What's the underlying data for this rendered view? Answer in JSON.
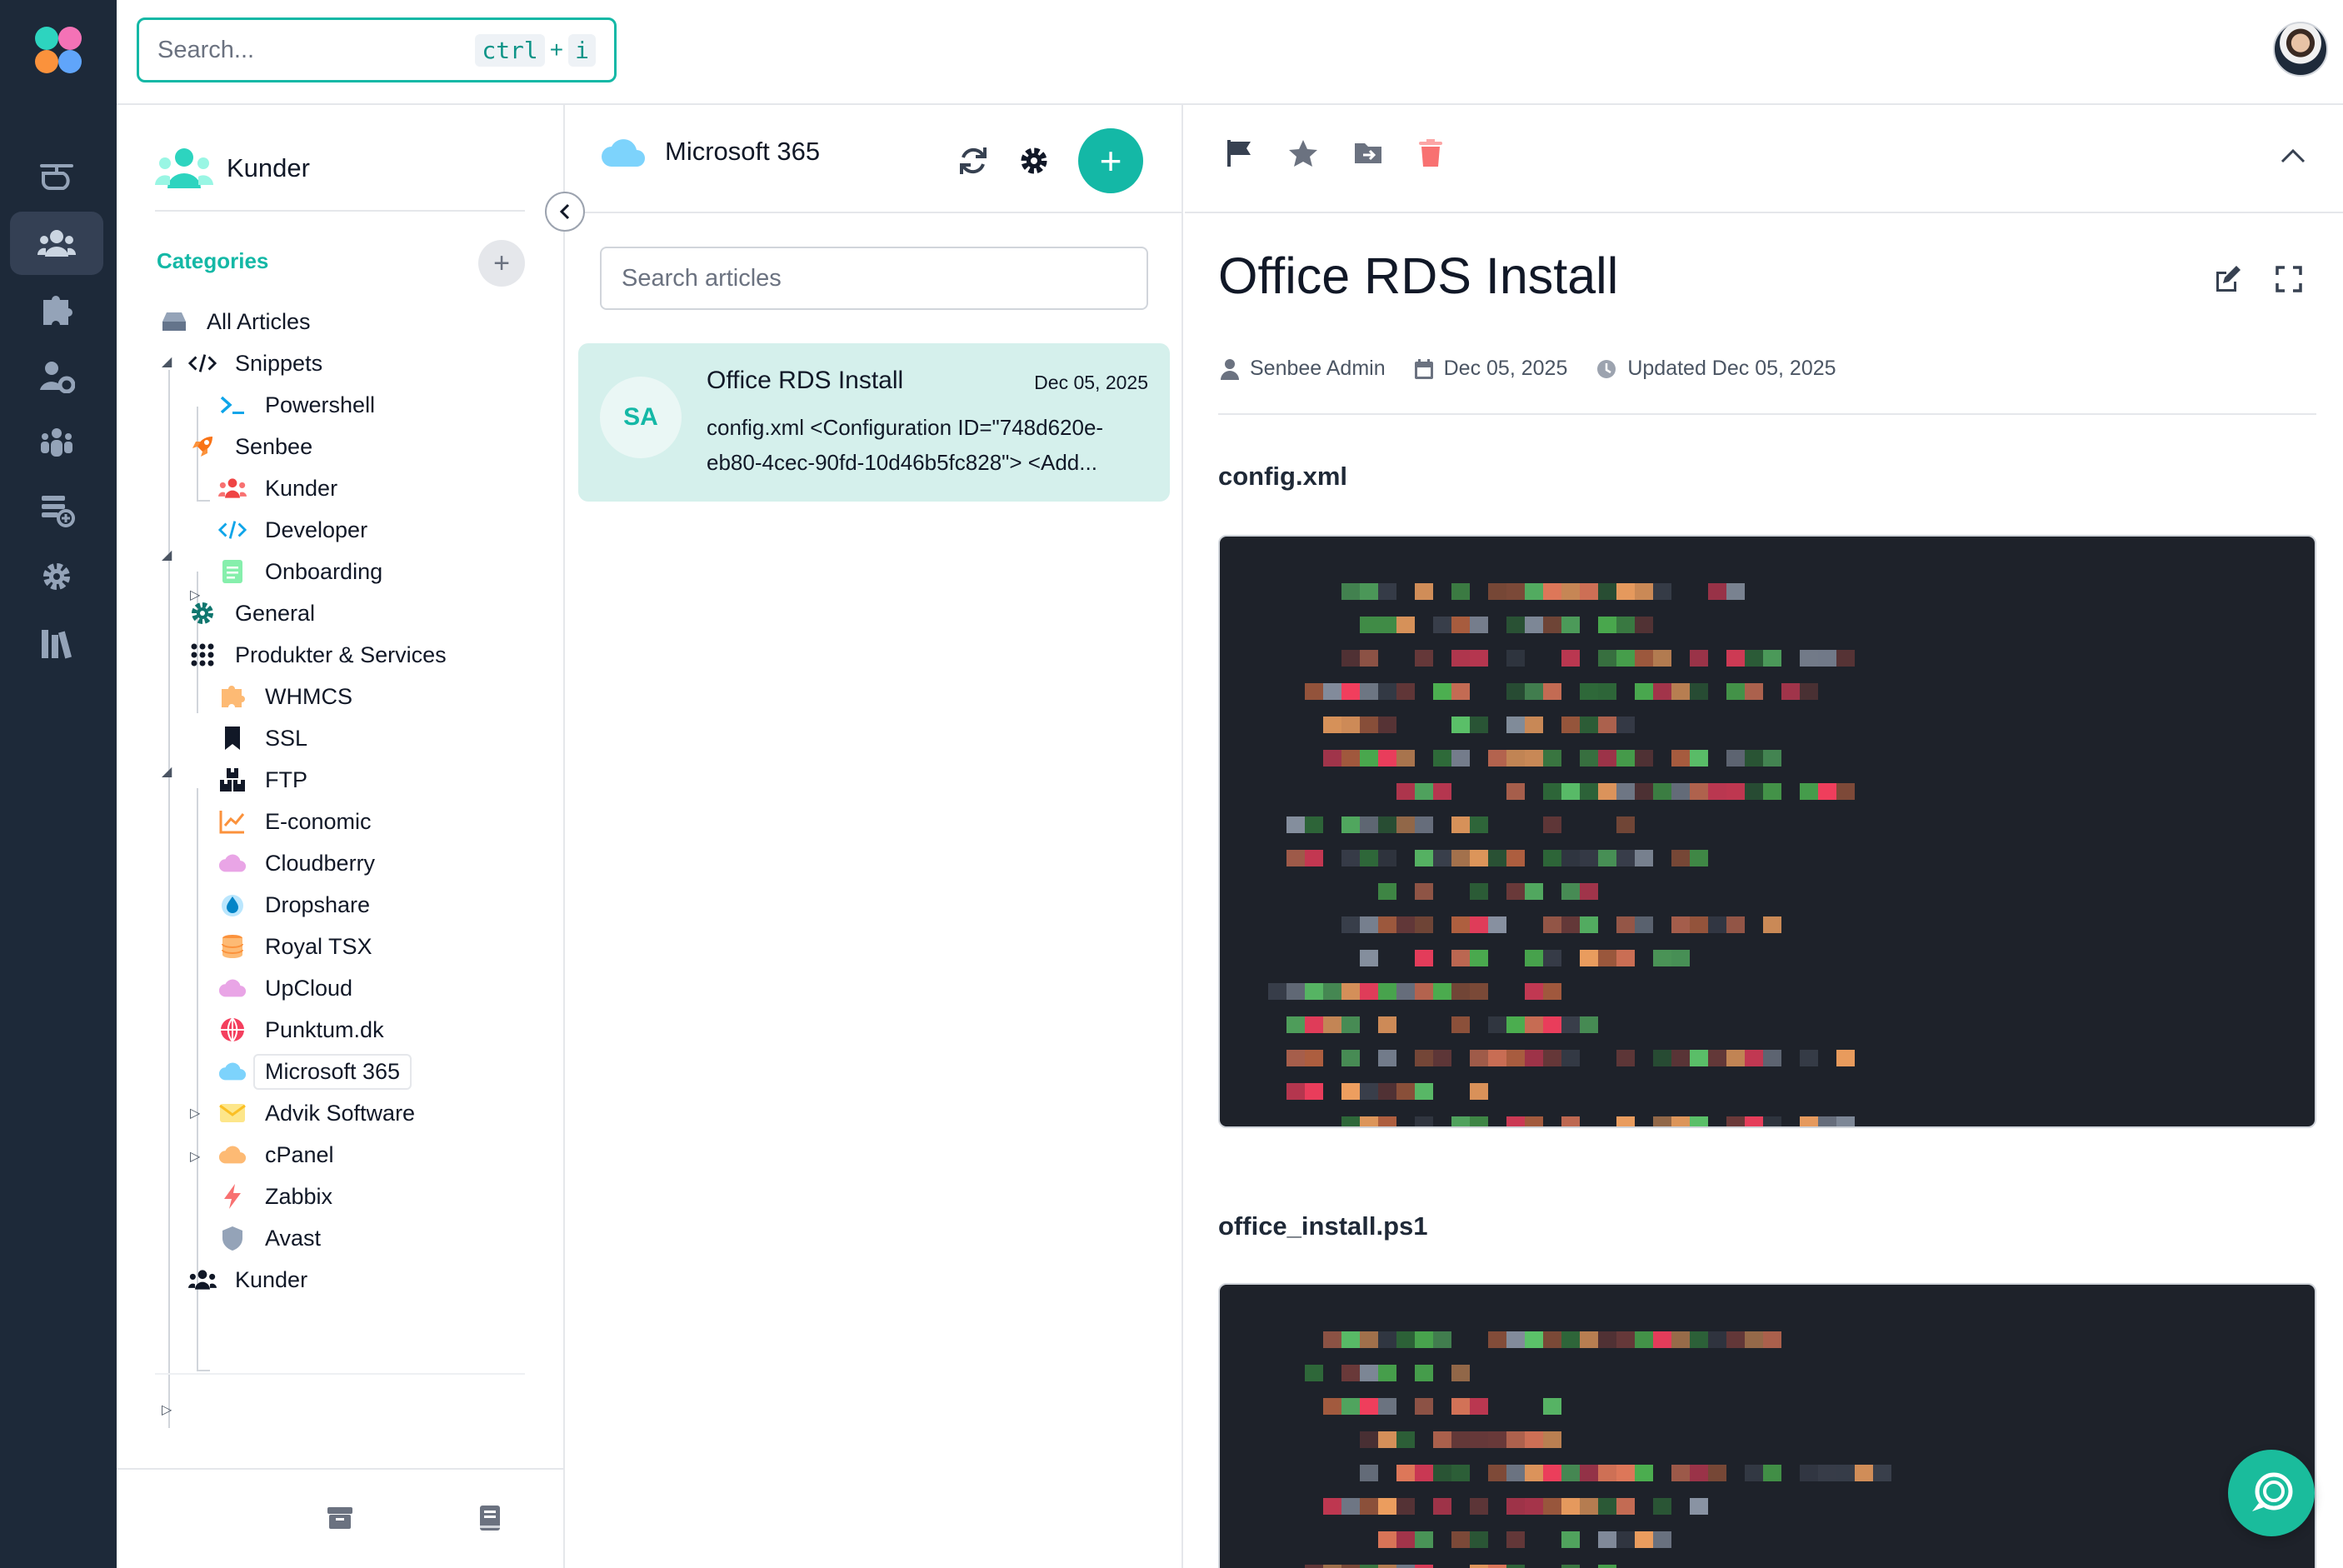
{
  "app": {
    "colors": {
      "accent": "#14b8a6",
      "rail": "#1d2939",
      "card": "#d5f0ec"
    }
  },
  "rail": {
    "items": [
      {
        "icon": "helicopter-icon",
        "active": false
      },
      {
        "icon": "users-icon",
        "active": true
      },
      {
        "icon": "puzzle-icon",
        "active": false
      },
      {
        "icon": "user-gear-icon",
        "active": false
      },
      {
        "icon": "people-group-icon",
        "active": false
      },
      {
        "icon": "layers-add-icon",
        "active": false
      },
      {
        "icon": "gear-icon",
        "active": false
      },
      {
        "icon": "books-icon",
        "active": false
      }
    ]
  },
  "topbar": {
    "search": {
      "placeholder": "Search...",
      "shortcut_key1": "ctrl",
      "shortcut_plus": "+",
      "shortcut_key2": "i"
    }
  },
  "categories": {
    "space_title": "Kunder",
    "section_label": "Categories",
    "add_label": "+",
    "tree": [
      {
        "label": "All Articles",
        "icon": "inbox-icon"
      },
      {
        "label": "Snippets",
        "icon": "code-icon"
      },
      {
        "label": "Powershell",
        "icon": "terminal-icon"
      },
      {
        "label": "Senbee",
        "icon": "rocket-icon"
      },
      {
        "label": "Kunder",
        "icon": "users-icon"
      },
      {
        "label": "Developer",
        "icon": "code-icon"
      },
      {
        "label": "Onboarding",
        "icon": "document-icon"
      },
      {
        "label": "General",
        "icon": "gear-icon"
      },
      {
        "label": "Produkter & Services",
        "icon": "grid-icon"
      },
      {
        "label": "WHMCS",
        "icon": "puzzle-icon"
      },
      {
        "label": "SSL",
        "icon": "bookmark-icon"
      },
      {
        "label": "FTP",
        "icon": "boxes-icon"
      },
      {
        "label": "E-conomic",
        "icon": "chart-line-icon"
      },
      {
        "label": "Cloudberry",
        "icon": "cloud-icon"
      },
      {
        "label": "Dropshare",
        "icon": "droplet-icon"
      },
      {
        "label": "Royal TSX",
        "icon": "database-icon"
      },
      {
        "label": "UpCloud",
        "icon": "cloud-icon"
      },
      {
        "label": "Punktum.dk",
        "icon": "globe-icon"
      },
      {
        "label": "Microsoft 365",
        "icon": "cloud-icon"
      },
      {
        "label": "Advik Software",
        "icon": "envelope-icon"
      },
      {
        "label": "cPanel",
        "icon": "cloud-icon"
      },
      {
        "label": "Zabbix",
        "icon": "bolt-icon"
      },
      {
        "label": "Avast",
        "icon": "shield-icon"
      },
      {
        "label": "Kunder",
        "icon": "users-icon"
      }
    ]
  },
  "articles": {
    "category_title": "Microsoft 365",
    "add_label": "+",
    "search_placeholder": "Search articles",
    "list": [
      {
        "initials": "SA",
        "title": "Office RDS Install",
        "date": "Dec 05, 2025",
        "snippet": "config.xml <Configuration ID=\"748d620e-eb80-4cec-90fd-10d46b5fc828\"> <Add..."
      }
    ]
  },
  "detail": {
    "title": "Office RDS Install",
    "author": "Senbee Admin",
    "created": "Dec 05, 2025",
    "updated": "Updated Dec 05, 2025",
    "sections": [
      {
        "heading": "config.xml"
      },
      {
        "heading": "office_install.ps1"
      }
    ]
  }
}
